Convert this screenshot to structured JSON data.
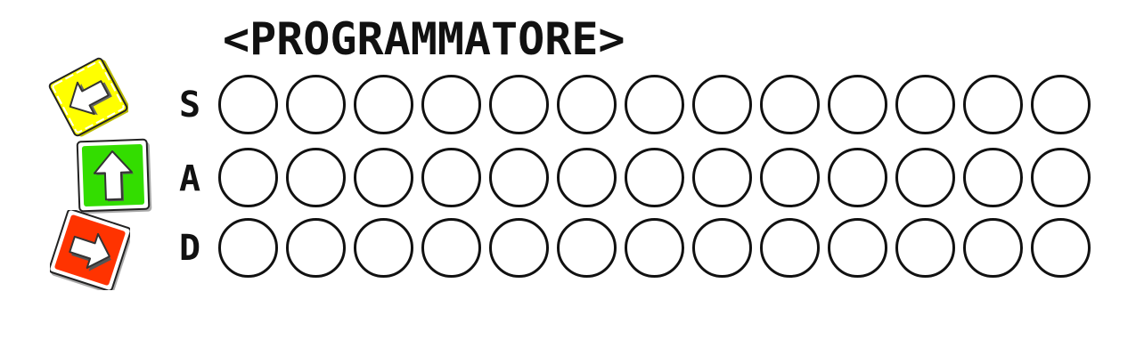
{
  "title": "<PROGRAMMATORE>",
  "rows": [
    {
      "key": "S",
      "tile_color": "#ffff00",
      "icon": "arrow-left-icon",
      "slot_count": 13
    },
    {
      "key": "A",
      "tile_color": "#33dd00",
      "icon": "arrow-up-icon",
      "slot_count": 13
    },
    {
      "key": "D",
      "tile_color": "#ff3300",
      "icon": "arrow-right-icon",
      "slot_count": 13
    }
  ],
  "colors": {
    "ink": "#111111",
    "background": "#ffffff"
  }
}
